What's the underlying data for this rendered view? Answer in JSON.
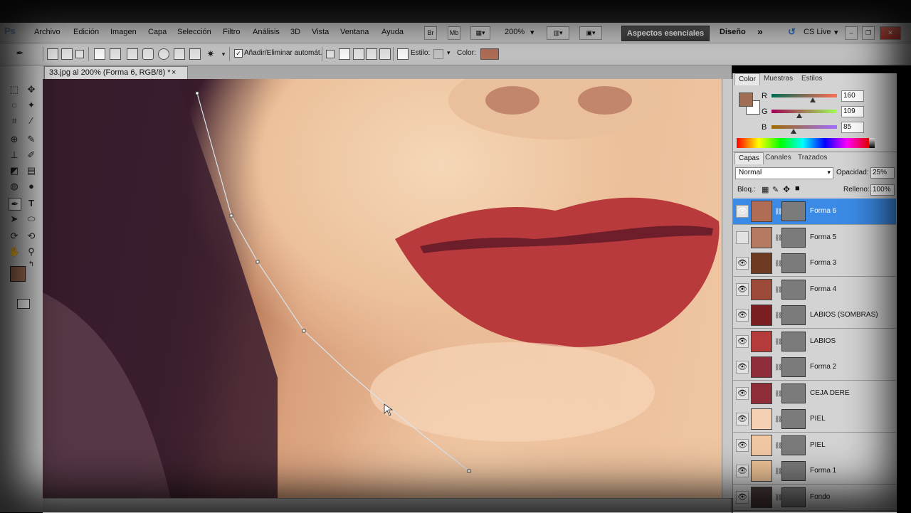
{
  "menu": {
    "items": [
      "Archivo",
      "Edición",
      "Imagen",
      "Capa",
      "Selección",
      "Filtro",
      "Análisis",
      "3D",
      "Vista",
      "Ventana",
      "Ayuda"
    ],
    "bridge": "Br",
    "minibridge": "Mb",
    "zoom": "200%",
    "workspace_active": "Aspectos esenciales",
    "workspace_other": "Diseño",
    "more": "»",
    "cs_live": "CS Live"
  },
  "options": {
    "auto_add_delete_label": "Añadir/Eliminar automát.",
    "style_label": "Estilo:",
    "color_label": "Color:",
    "color_value": "#b5705a"
  },
  "document": {
    "tab_title": "33.jpg al 200% (Forma 6, RGB/8) *",
    "close": "×"
  },
  "color_panel": {
    "tabs": [
      "Color",
      "Muestras",
      "Estilos"
    ],
    "r_label": "R",
    "g_label": "G",
    "b_label": "B",
    "r": 160,
    "g": 109,
    "b": 85,
    "fg_color": "#a06d55",
    "bg_color": "#ffffff"
  },
  "layers_panel": {
    "tabs": [
      "Capas",
      "Canales",
      "Trazados"
    ],
    "blend_mode": "Normal",
    "opacity_label": "Opacidad:",
    "opacity": "25%",
    "lock_label": "Bloq.:",
    "fill_label": "Relleno:",
    "fill": "100%",
    "layers": [
      {
        "name": "Forma 6",
        "color": "#b06c55",
        "visible": true,
        "selected": true
      },
      {
        "name": "Forma 5",
        "color": "#b57a62",
        "visible": false,
        "selected": false
      },
      {
        "name": "Forma 3",
        "color": "#6e3a22",
        "visible": true,
        "selected": false
      },
      {
        "name": "Forma 4",
        "color": "#9c4a3a",
        "visible": true,
        "selected": false
      },
      {
        "name": "LABIOS (SOMBRAS)",
        "color": "#7a1e22",
        "visible": true,
        "selected": false
      },
      {
        "name": "LABIOS",
        "color": "#b53a3a",
        "visible": true,
        "selected": false
      },
      {
        "name": "Forma 2",
        "color": "#8f2c3a",
        "visible": true,
        "selected": false
      },
      {
        "name": "CEJA DERE",
        "color": "#8e2c38",
        "visible": true,
        "selected": false
      },
      {
        "name": "PIEL",
        "color": "#f5cfb2",
        "visible": true,
        "selected": false
      },
      {
        "name": "PIEL",
        "color": "#f2c8a4",
        "visible": true,
        "selected": false
      },
      {
        "name": "Forma 1",
        "color": "#f0c496",
        "visible": true,
        "selected": false
      },
      {
        "name": "Fondo",
        "color": "#4a3a3a",
        "visible": true,
        "selected": false
      }
    ]
  },
  "canvas_colors": {
    "lips": "#b93a3c",
    "lip_line": "#6e1e2a",
    "path": "#d8e4ee"
  }
}
